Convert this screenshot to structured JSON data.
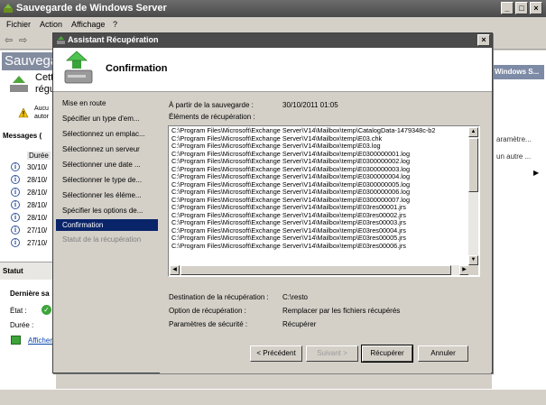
{
  "main": {
    "title": "Sauvegarde de Windows Server",
    "menu": [
      "Fichier",
      "Action",
      "Affichage",
      "?"
    ],
    "banner": "Sauvegar",
    "bg_texts": {
      "cette": "Cett",
      "regu": "régu",
      "aucu": "Aucu",
      "auto": "autor",
      "messages": "Messages (",
      "duree_col": "Durée",
      "dates": [
        "30/10/",
        "28/10/",
        "28/10/",
        "28/10/",
        "28/10/",
        "27/10/",
        "27/10/"
      ],
      "statut": "Statut",
      "derniere": "Dernière sa",
      "etat": "État :",
      "duree": "Durée :",
      "afficher": "Afficher"
    },
    "actions_header": "Windows S...",
    "side_links": [
      "aramètre...",
      "un autre ..."
    ]
  },
  "dialog": {
    "title": "Assistant Récupération",
    "header_title": "Confirmation",
    "steps": [
      {
        "label": "Mise en route",
        "state": "normal"
      },
      {
        "label": "Spécifier un type d'em...",
        "state": "normal"
      },
      {
        "label": "Sélectionnez un emplac...",
        "state": "normal"
      },
      {
        "label": "Sélectionnez un serveur",
        "state": "normal"
      },
      {
        "label": "Sélectionner une date ...",
        "state": "normal"
      },
      {
        "label": "Sélectionner le type de...",
        "state": "normal"
      },
      {
        "label": "Sélectionner les éléme...",
        "state": "normal"
      },
      {
        "label": "Spécifier les options de...",
        "state": "normal"
      },
      {
        "label": "Confirmation",
        "state": "active"
      },
      {
        "label": "Statut de la récupération",
        "state": "disabled"
      }
    ],
    "backup_from_label": "À partir de la sauvegarde :",
    "backup_from_value": "30/10/2011 01:05",
    "items_label": "Éléments de récupération :",
    "items": [
      "C:\\Program Files\\Microsoft\\Exchange Server\\V14\\Mailbox\\temp\\CatalogData-1479348c-b2",
      "C:\\Program Files\\Microsoft\\Exchange Server\\V14\\Mailbox\\temp\\E03.chk",
      "C:\\Program Files\\Microsoft\\Exchange Server\\V14\\Mailbox\\temp\\E03.log",
      "C:\\Program Files\\Microsoft\\Exchange Server\\V14\\Mailbox\\temp\\E0300000001.log",
      "C:\\Program Files\\Microsoft\\Exchange Server\\V14\\Mailbox\\temp\\E0300000002.log",
      "C:\\Program Files\\Microsoft\\Exchange Server\\V14\\Mailbox\\temp\\E0300000003.log",
      "C:\\Program Files\\Microsoft\\Exchange Server\\V14\\Mailbox\\temp\\E0300000004.log",
      "C:\\Program Files\\Microsoft\\Exchange Server\\V14\\Mailbox\\temp\\E0300000005.log",
      "C:\\Program Files\\Microsoft\\Exchange Server\\V14\\Mailbox\\temp\\E0300000006.log",
      "C:\\Program Files\\Microsoft\\Exchange Server\\V14\\Mailbox\\temp\\E0300000007.log",
      "C:\\Program Files\\Microsoft\\Exchange Server\\V14\\Mailbox\\temp\\E03res00001.jrs",
      "C:\\Program Files\\Microsoft\\Exchange Server\\V14\\Mailbox\\temp\\E03res00002.jrs",
      "C:\\Program Files\\Microsoft\\Exchange Server\\V14\\Mailbox\\temp\\E03res00003.jrs",
      "C:\\Program Files\\Microsoft\\Exchange Server\\V14\\Mailbox\\temp\\E03res00004.jrs",
      "C:\\Program Files\\Microsoft\\Exchange Server\\V14\\Mailbox\\temp\\E03res00005.jrs",
      "C:\\Program Files\\Microsoft\\Exchange Server\\V14\\Mailbox\\temp\\E03res00006.jrs"
    ],
    "destination_label": "Destination de la récupération :",
    "destination_value": "C:\\resto",
    "option_label": "Option de récupération :",
    "option_value": "Remplacer par les fichiers récupérés",
    "security_label": "Paramètres de sécurité :",
    "security_value": "Récupérer",
    "buttons": {
      "previous": "< Précédent",
      "next": "Suivant >",
      "recover": "Récupérer",
      "cancel": "Annuler"
    }
  },
  "colors": {
    "title_bar": "#4b4b4b",
    "selection": "#0a246a",
    "face": "#d4d0c8",
    "panel_header": "#7e8ba6"
  }
}
